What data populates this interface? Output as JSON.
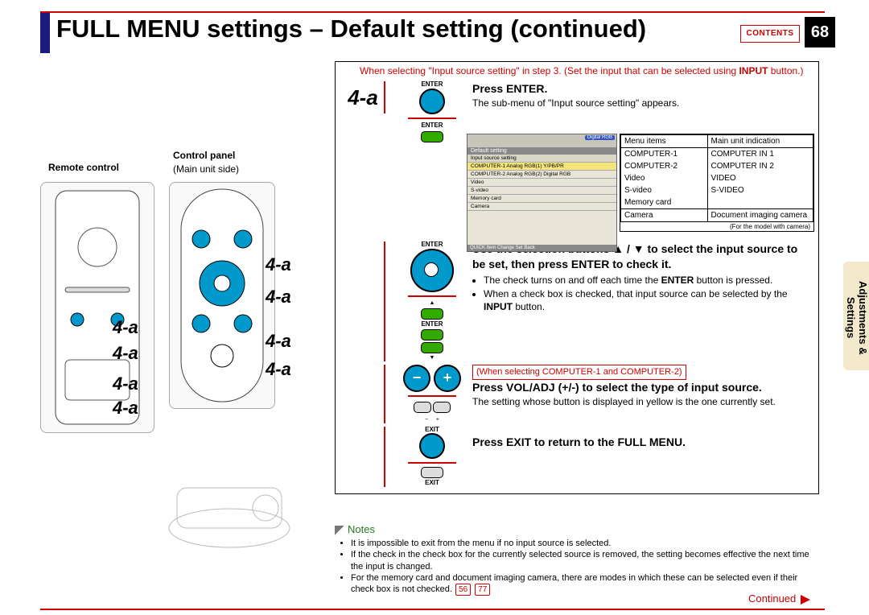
{
  "header": {
    "title": "FULL MENU settings – Default setting (continued)",
    "contents_btn": "CONTENTS",
    "page_number": "68"
  },
  "side_tab": "Adjustments & Settings",
  "remote": {
    "label": "Remote control",
    "panel_label": "Control panel",
    "panel_sub": "(Main unit side)",
    "callouts": [
      "4-a",
      "4-a",
      "4-a",
      "4-a",
      "4-a",
      "4-a",
      "4-a"
    ]
  },
  "intro": {
    "line1": "When selecting \"Input source setting\" in step 3. (Set the input that can be selected using ",
    "input_btn": "INPUT",
    "line1_end": " button.)"
  },
  "step4a": {
    "num": "4-a",
    "icon_enter_top": "ENTER",
    "icon_enter_bottom": "ENTER",
    "head": "Press ENTER.",
    "body": "The sub-menu of \"Input source setting\" appears."
  },
  "grid": {
    "col1_head": "Menu items",
    "col2_head": "Main unit indication",
    "rows": [
      [
        "COMPUTER-1",
        "COMPUTER IN 1"
      ],
      [
        "COMPUTER-2",
        "COMPUTER IN 2"
      ],
      [
        "Video",
        "VIDEO"
      ],
      [
        "S-video",
        "S-VIDEO"
      ],
      [
        "Memory card",
        ""
      ]
    ],
    "camera_row": [
      "Camera",
      "Document imaging camera"
    ],
    "note": "(For the model with camera)"
  },
  "osd": {
    "title": "Default setting",
    "row1": "Input source setting",
    "items": [
      "COMPUTER-1  Analog RGB(1) Y/PB/PR",
      "COMPUTER-2  Analog RGB(2) Digital RGB",
      "Video",
      "S-video",
      "Memory card",
      "Camera"
    ],
    "footer": "QUICK   Item   Change   Set   Back",
    "topbadge": "Digital RGB"
  },
  "step_select": {
    "icon_enter_top": "ENTER",
    "icon_enter_bottom": "ENTER",
    "head": "Use the selection buttons ▲ / ▼ to select the input source to be set, then press ENTER to check it.",
    "bullet1a": "The check turns on and off each time the ",
    "bullet1_b": "ENTER",
    "bullet1c": " button is pressed.",
    "bullet2a": "When a check box is checked, that input source can be selected by the ",
    "bullet2_b": "INPUT",
    "bullet2c": " button."
  },
  "step_vol": {
    "red_note": "(When selecting COMPUTER-1 and COMPUTER-2)",
    "head": "Press VOL/ADJ (+/-) to select the type of input source.",
    "body": "The setting whose button is displayed in yellow is the one currently set."
  },
  "step_exit": {
    "icon_label": "EXIT",
    "head": "Press EXIT to return to the FULL MENU."
  },
  "notes": {
    "title": "Notes",
    "items": [
      "It is impossible to exit from the menu if no input source is selected.",
      "If the check in the check box for the currently selected source is removed, the setting becomes effective the next time the input is changed."
    ],
    "item3a": "For the memory card and document imaging camera, there are modes in which these can be selected even if their check box is not checked.",
    "ref1": "56",
    "ref2": "77"
  },
  "continued": "Continued"
}
